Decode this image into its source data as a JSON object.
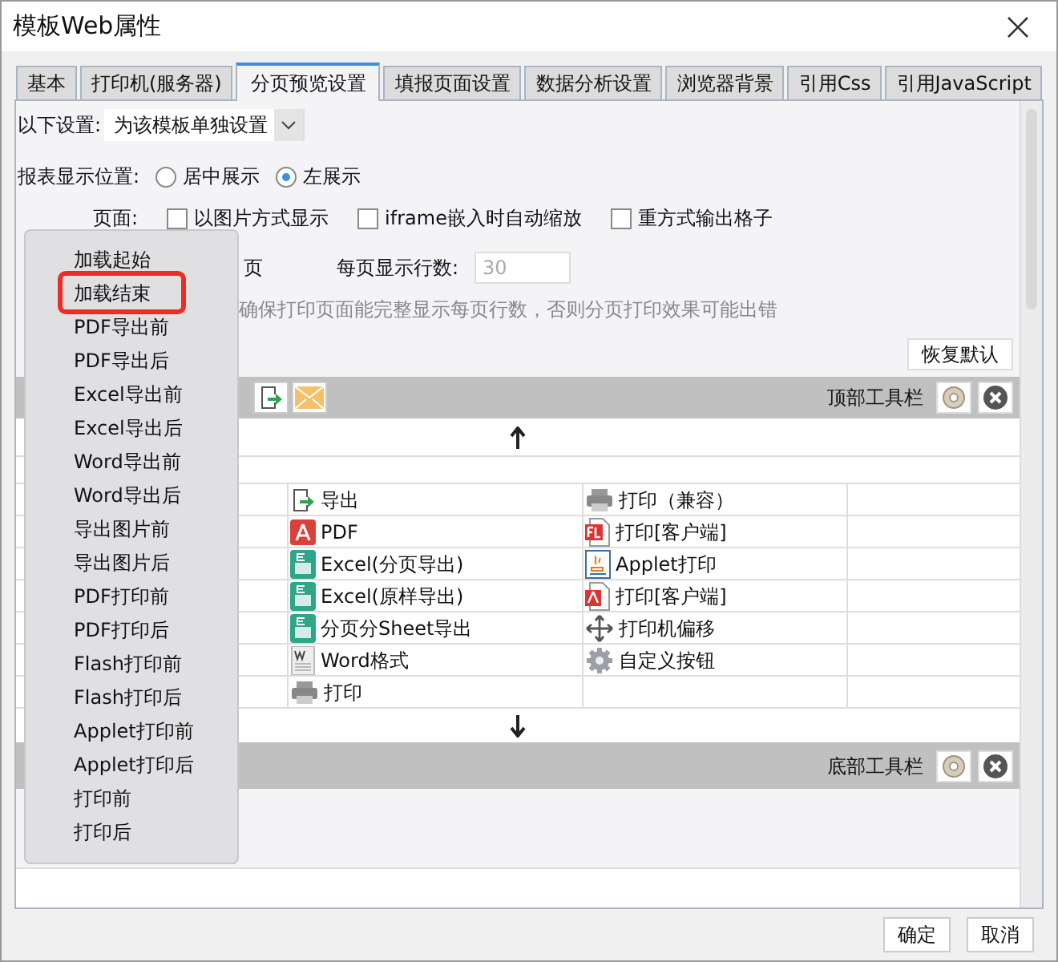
{
  "window": {
    "title": "模板Web属性"
  },
  "tabs": [
    {
      "label": "基本",
      "selected": false
    },
    {
      "label": "打印机(服务器)",
      "selected": false
    },
    {
      "label": "分页预览设置",
      "selected": true
    },
    {
      "label": "填报页面设置",
      "selected": false
    },
    {
      "label": "数据分析设置",
      "selected": false
    },
    {
      "label": "浏览器背景",
      "selected": false
    },
    {
      "label": "引用Css",
      "selected": false
    },
    {
      "label": "引用JavaScript",
      "selected": false
    }
  ],
  "settings_scope": {
    "label": "以下设置:",
    "value": "为该模板单独设置"
  },
  "report_position": {
    "label": "报表显示位置:",
    "options": [
      {
        "label": "居中展示",
        "selected": false
      },
      {
        "label": "左展示",
        "selected": true
      }
    ]
  },
  "page_options": {
    "label": "页面:",
    "checkboxes": [
      {
        "label": "以图片方式显示",
        "checked": false
      },
      {
        "label": "iframe嵌入时自动缩放",
        "checked": false
      },
      {
        "label": "重方式输出格子",
        "checked": false
      }
    ]
  },
  "rows_per_page": {
    "prefix": "页",
    "label": "每页显示行数:",
    "value": "30",
    "disabled": true
  },
  "hint": "确保打印页面能完整显示每页行数，否则分页打印效果可能出错",
  "restore_button": "恢复默认",
  "top_toolbar": {
    "label": "顶部工具栏"
  },
  "button_grid": {
    "rows": [
      {
        "col_2": {
          "kind": "export",
          "label": "导出"
        },
        "col_3": {
          "kind": "printer",
          "label": "打印（兼容）"
        }
      },
      {
        "col_2": {
          "kind": "pdf",
          "label": "PDF"
        },
        "col_3": {
          "kind": "flash",
          "label": "打印[客户端]"
        }
      },
      {
        "col_2": {
          "kind": "excel",
          "label": "Excel(分页导出)"
        },
        "col_3": {
          "kind": "applet",
          "label": "Applet打印"
        }
      },
      {
        "col_2": {
          "kind": "excel",
          "label": "Excel(原样导出)"
        },
        "col_3": {
          "kind": "pdfdoc",
          "label": "打印[客户端]"
        }
      },
      {
        "col_2": {
          "kind": "excel",
          "label": "分页分Sheet导出"
        },
        "col_3": {
          "kind": "move",
          "label": "打印机偏移"
        }
      },
      {
        "col_2": {
          "kind": "word",
          "label": "Word格式"
        },
        "col_3": {
          "kind": "gear",
          "label": "自定义按钮"
        }
      },
      {
        "col_2": {
          "kind": "printer",
          "label": "打印"
        }
      }
    ]
  },
  "bottom_toolbar": {
    "label": "底部工具栏"
  },
  "event_menu": {
    "items": [
      {
        "label": "加载起始",
        "selected": false
      },
      {
        "label": "加载结束",
        "selected": true
      },
      {
        "label": "PDF导出前",
        "selected": false
      },
      {
        "label": "PDF导出后",
        "selected": false
      },
      {
        "label": "Excel导出前",
        "selected": false
      },
      {
        "label": "Excel导出后",
        "selected": false
      },
      {
        "label": "Word导出前",
        "selected": false
      },
      {
        "label": "Word导出后",
        "selected": false
      },
      {
        "label": "导出图片前",
        "selected": false
      },
      {
        "label": "导出图片后",
        "selected": false
      },
      {
        "label": "PDF打印前",
        "selected": false
      },
      {
        "label": "PDF打印后",
        "selected": false
      },
      {
        "label": "Flash打印前",
        "selected": false
      },
      {
        "label": "Flash打印后",
        "selected": false
      },
      {
        "label": "Applet打印前",
        "selected": false
      },
      {
        "label": "Applet打印后",
        "selected": false
      },
      {
        "label": "打印前",
        "selected": false
      },
      {
        "label": "打印后",
        "selected": false
      }
    ]
  },
  "buttons": [
    "确定",
    "取消"
  ]
}
